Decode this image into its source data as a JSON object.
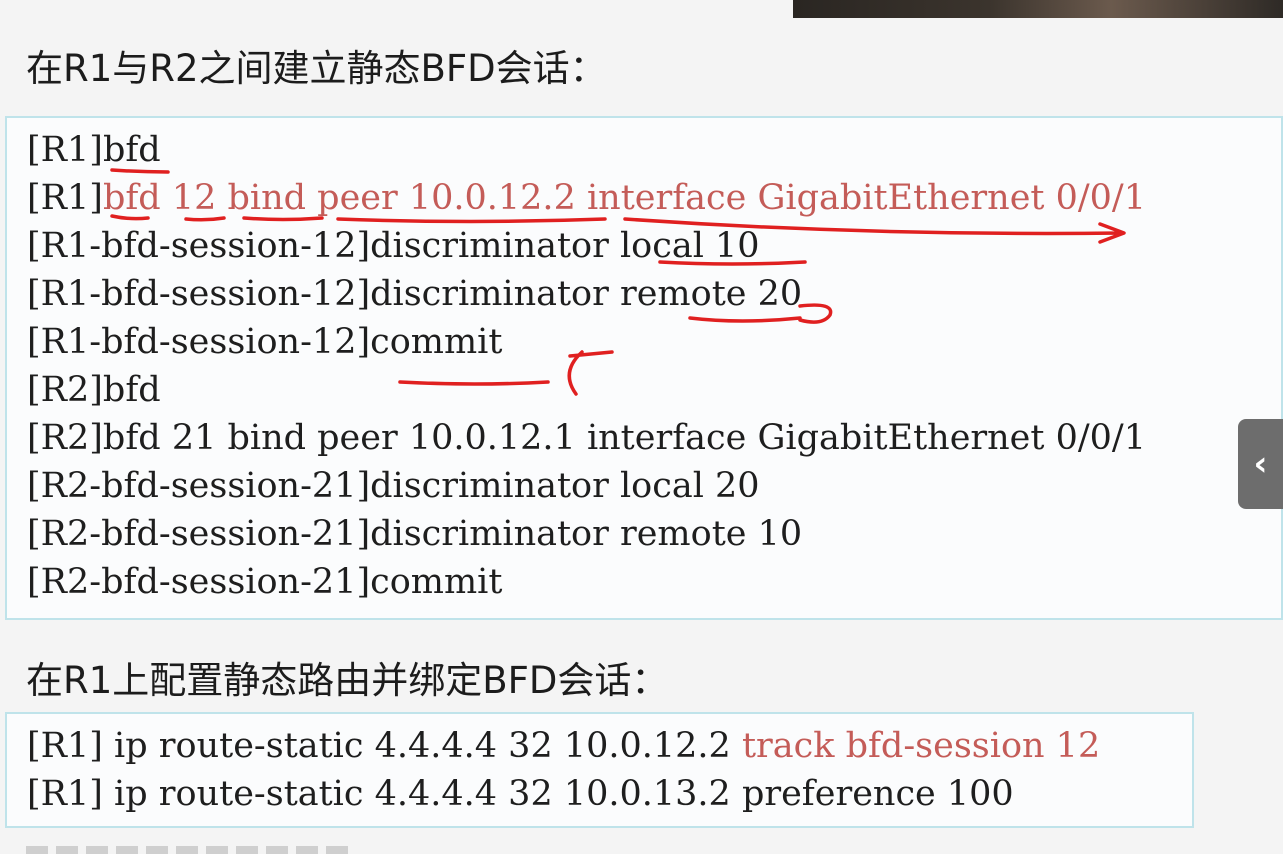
{
  "slide": {
    "heading_1": "在R1与R2之间建立静态BFD会话：",
    "heading_2": "在R1上配置静态路由并绑定BFD会话：",
    "block_1": [
      {
        "prefix": "[R1]",
        "text": "bfd",
        "highlight": ""
      },
      {
        "prefix": "[R1]",
        "text": "",
        "highlight": "bfd 12 bind peer 10.0.12.2 interface GigabitEthernet 0/0/1"
      },
      {
        "prefix": "",
        "text": "[R1-bfd-session-12]discriminator local 10",
        "highlight": ""
      },
      {
        "prefix": "",
        "text": "[R1-bfd-session-12]discriminator remote 20",
        "highlight": ""
      },
      {
        "prefix": "",
        "text": "[R1-bfd-session-12]commit",
        "highlight": ""
      },
      {
        "prefix": "",
        "text": "[R2]bfd",
        "highlight": ""
      },
      {
        "prefix": "",
        "text": "[R2]bfd 21 bind peer 10.0.12.1 interface GigabitEthernet 0/0/1",
        "highlight": ""
      },
      {
        "prefix": "",
        "text": "[R2-bfd-session-21]discriminator local 20",
        "highlight": ""
      },
      {
        "prefix": "",
        "text": "[R2-bfd-session-21]discriminator remote 10",
        "highlight": ""
      },
      {
        "prefix": "",
        "text": "[R2-bfd-session-21]commit",
        "highlight": ""
      }
    ],
    "block_2": [
      {
        "prefix": "",
        "text": "[R1] ip route-static 4.4.4.4 32 10.0.12.2 ",
        "highlight": "track bfd-session 12"
      },
      {
        "prefix": "",
        "text": "[R1] ip route-static 4.4.4.4 32 10.0.13.2 preference 100",
        "highlight": ""
      }
    ]
  },
  "nav": {
    "prev_icon": "‹"
  },
  "colors": {
    "highlight": "#c45c58",
    "annotation": "#e02020",
    "box_border": "#bfe3ea"
  }
}
